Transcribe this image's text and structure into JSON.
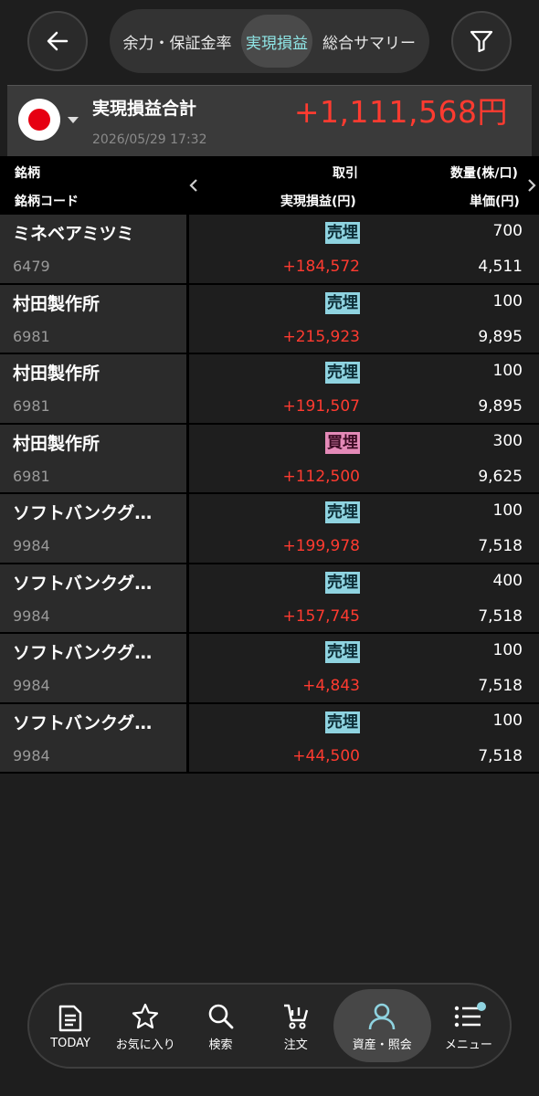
{
  "header": {
    "tabs": [
      {
        "label": "余力・保証金率"
      },
      {
        "label": "実現損益"
      },
      {
        "label": "総合サマリー"
      }
    ]
  },
  "summary": {
    "title": "実現損益合計",
    "date": "2026/05/29 17:32",
    "total": "+1,111,568円"
  },
  "columns": {
    "name": "銘柄",
    "code": "銘柄コード",
    "trade": "取引",
    "pnl": "実現損益(円)",
    "qty": "数量(株/口)",
    "price": "単価(円)"
  },
  "rows": [
    {
      "name": "ミネベアミツミ",
      "code": "6479",
      "trade": "売埋",
      "pnl": "+184,572",
      "qty": "700",
      "price": "4,511"
    },
    {
      "name": "村田製作所",
      "code": "6981",
      "trade": "売埋",
      "pnl": "+215,923",
      "qty": "100",
      "price": "9,895"
    },
    {
      "name": "村田製作所",
      "code": "6981",
      "trade": "売埋",
      "pnl": "+191,507",
      "qty": "100",
      "price": "9,895"
    },
    {
      "name": "村田製作所",
      "code": "6981",
      "trade": "買埋",
      "pnl": "+112,500",
      "qty": "300",
      "price": "9,625"
    },
    {
      "name": "ソフトバンクグ…",
      "code": "9984",
      "trade": "売埋",
      "pnl": "+199,978",
      "qty": "100",
      "price": "7,518"
    },
    {
      "name": "ソフトバンクグ…",
      "code": "9984",
      "trade": "売埋",
      "pnl": "+157,745",
      "qty": "400",
      "price": "7,518"
    },
    {
      "name": "ソフトバンクグ…",
      "code": "9984",
      "trade": "売埋",
      "pnl": "+4,843",
      "qty": "100",
      "price": "7,518"
    },
    {
      "name": "ソフトバンクグ…",
      "code": "9984",
      "trade": "売埋",
      "pnl": "+44,500",
      "qty": "100",
      "price": "7,518"
    }
  ],
  "nav": [
    {
      "label": "TODAY",
      "icon": "document-icon"
    },
    {
      "label": "お気に入り",
      "icon": "star-icon"
    },
    {
      "label": "検索",
      "icon": "search-icon"
    },
    {
      "label": "注文",
      "icon": "cart-icon"
    },
    {
      "label": "資産・照会",
      "icon": "person-icon"
    },
    {
      "label": "メニュー",
      "icon": "list-icon"
    }
  ],
  "colors": {
    "accent": "#8fe6e6",
    "profit": "#ff3b30",
    "sell_badge": "#8fd3e0",
    "buy_badge": "#e48ab8"
  }
}
